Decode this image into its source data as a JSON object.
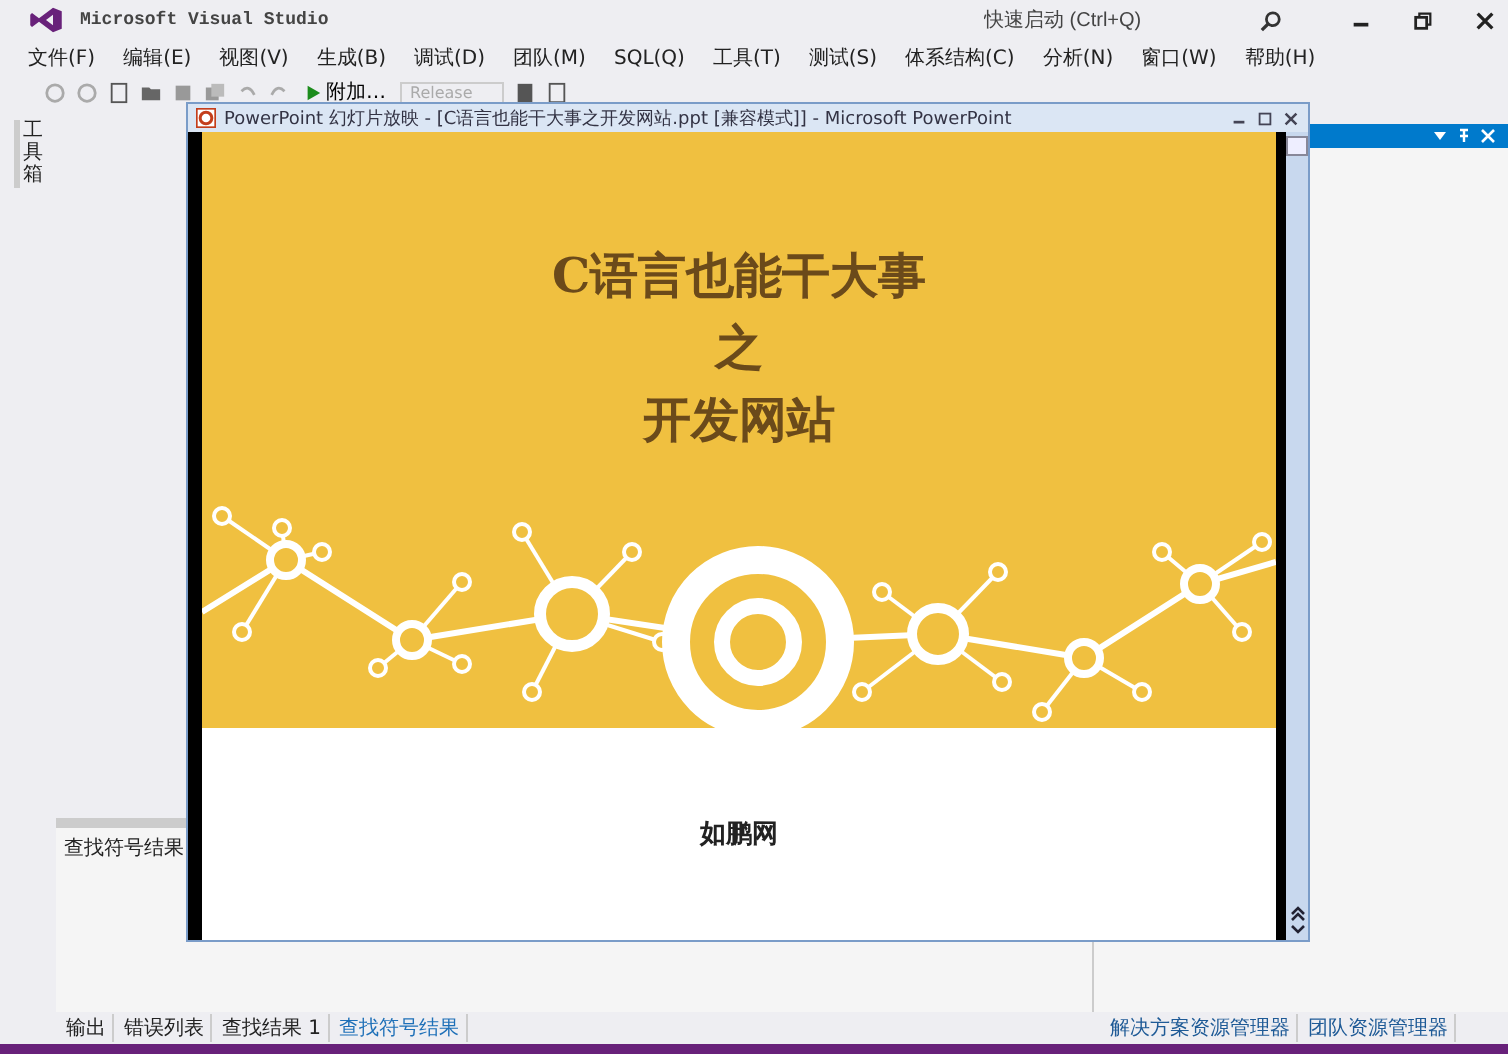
{
  "app": {
    "title": "Microsoft Visual Studio",
    "quick_launch": {
      "placeholder": "快速启动 (Ctrl+Q)"
    }
  },
  "menu": [
    "文件(F)",
    "编辑(E)",
    "视图(V)",
    "生成(B)",
    "调试(D)",
    "团队(M)",
    "SQL(Q)",
    "工具(T)",
    "测试(S)",
    "体系结构(C)",
    "分析(N)",
    "窗口(W)",
    "帮助(H)"
  ],
  "toolbar": {
    "attach_button": "附加…",
    "config_select": "Release"
  },
  "sidebar": {
    "tab": "工具箱"
  },
  "slideshow": {
    "title": "PowerPoint 幻灯片放映 - [C语言也能干大事之开发网站.ppt [兼容模式]] - Microsoft PowerPoint",
    "slide": {
      "title_lines": [
        "C语言也能干大事",
        "之",
        "开发网站"
      ],
      "footer": "如鹏网"
    }
  },
  "find_panel": {
    "title": "查找符号结果"
  },
  "bottom_tabs": [
    {
      "label": "输出",
      "selected": false
    },
    {
      "label": "错误列表",
      "selected": false
    },
    {
      "label": "查找结果 1",
      "selected": false
    },
    {
      "label": "查找符号结果",
      "selected": true
    }
  ],
  "right_tabs": [
    "解决方案资源管理器",
    "团队资源管理器"
  ]
}
